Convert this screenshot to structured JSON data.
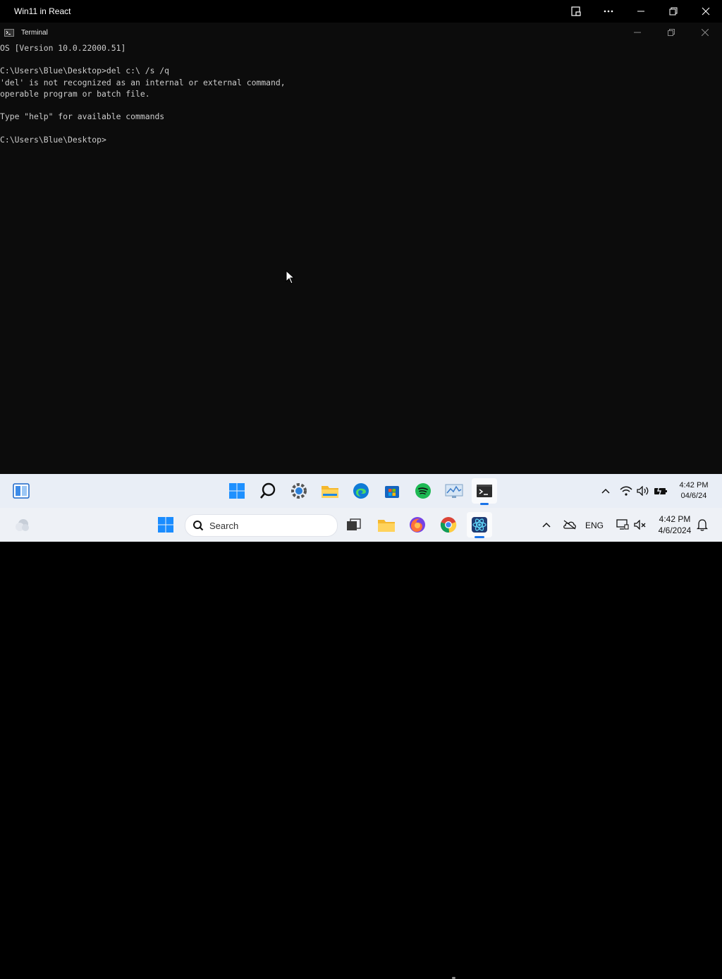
{
  "browser": {
    "title": "Win11 in React",
    "icons": [
      "cast-icon",
      "more-icon",
      "minimize-icon",
      "restore-icon",
      "close-icon"
    ]
  },
  "terminal": {
    "title": "Terminal",
    "lines": [
      "OS [Version 10.0.22000.51]",
      "",
      "C:\\Users\\Blue\\Desktop>del c:\\ /s /q",
      "'del' is not recognized as an internal or external command,",
      "operable program or batch file.",
      "",
      "Type \"help\" for available commands",
      "",
      "C:\\Users\\Blue\\Desktop>"
    ]
  },
  "inner_taskbar": {
    "apps": [
      "widgets-icon",
      "start-icon",
      "search-icon",
      "settings-icon",
      "file-explorer-icon",
      "edge-icon",
      "store-icon",
      "spotify-icon",
      "task-manager-icon",
      "terminal-icon"
    ],
    "tray": {
      "language": "",
      "time": "4:42 PM",
      "date": "04/6/24"
    }
  },
  "outer_taskbar": {
    "search_placeholder": "Search",
    "tray": {
      "language": "ENG",
      "time": "4:42 PM",
      "date": "4/6/2024"
    }
  },
  "colors": {
    "terminal_bg": "#0c0c0c",
    "terminal_text": "#cccccc",
    "taskbar_bg": "#e9eef6",
    "accent": "#1a73e8"
  }
}
